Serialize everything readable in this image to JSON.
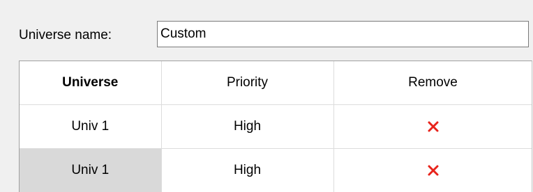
{
  "form": {
    "universe_name_label": "Universe name:",
    "universe_name_value": "Custom"
  },
  "table": {
    "columns": [
      "Universe",
      "Priority",
      "Remove"
    ],
    "rows": [
      {
        "universe": "Univ 1",
        "priority": "High",
        "remove_icon": "red-x-icon"
      },
      {
        "universe": "Univ 1",
        "priority": "High",
        "remove_icon": "red-x-icon"
      }
    ]
  },
  "colors": {
    "remove_icon": "#e8231b",
    "selected_cell": "#d9d9d9"
  }
}
